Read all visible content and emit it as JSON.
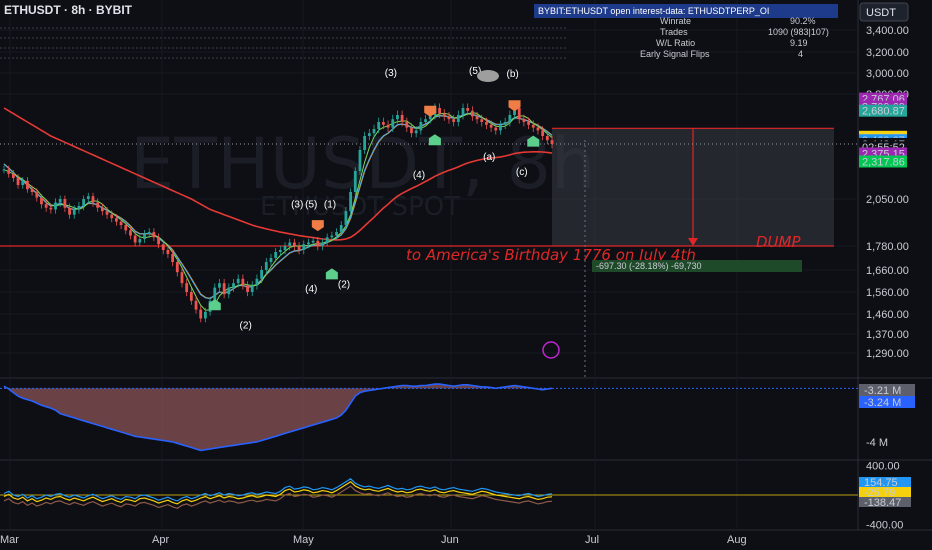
{
  "header": {
    "symbol": "ETHUSDT · 8h · BYBIT",
    "interest_banner": "BYBIT:ETHUSDT open interest-data: ETHUSDTPERP_OI",
    "currency_button": "USDT",
    "watermark_symbol": "ETHUSDT, 8h",
    "watermark_desc": "ETHUSDT SPOT"
  },
  "stats_table": {
    "rows": [
      {
        "label": "Winrate",
        "value": "90.2%"
      },
      {
        "label": "Trades",
        "value": "1090 (983|107)"
      },
      {
        "label": "W/L Ratio",
        "value": "9.19"
      },
      {
        "label": "Early Signal Flips",
        "value": "4"
      }
    ]
  },
  "annotations": {
    "dump_label": "DUMP",
    "birthday_text": "to America's Birthday 1776 on July 4th",
    "measure_text": "-697.30 (-28.18%) -69,730"
  },
  "colors": {
    "up": "#26a69a",
    "down": "#ef5350",
    "ema_red": "#e53935",
    "ema_orange": "#ff9800",
    "ema_blue": "#42a5f5",
    "ema_green": "#7ed957",
    "sell": "#ef7d45",
    "buy": "#5ccf8d"
  },
  "chart_data": [
    {
      "type": "candlestick",
      "name": "main-price",
      "title": "ETHUSDT, 8h",
      "ylim": [
        1290,
        3500
      ],
      "y_ticks": [
        3400,
        3200,
        3000,
        2800,
        2050,
        1780,
        1660,
        1560,
        1460,
        1370,
        1290
      ],
      "y_tick_labels": [
        "3,400.00",
        "3,200.00",
        "3,000.00",
        "2,800.00",
        "2,050.00",
        "1,780.00",
        "1,660.00",
        "1,560.00",
        "1,460.00",
        "1,370.00",
        "1,290.00"
      ],
      "x_tick_labels": [
        "Mar",
        "Apr",
        "May",
        "Jun",
        "Jul",
        "Aug"
      ],
      "price_labels": [
        {
          "value": 2767.06,
          "text": "2,767.06",
          "color": "#9c27b0"
        },
        {
          "value": 2709.69,
          "text": "2,709.69",
          "color": "#9c27b0"
        },
        {
          "value": 2680.87,
          "text": "2,680.87",
          "color": "#26a69a"
        },
        {
          "value": 2494.29,
          "text": "2,494.29",
          "color": "#f5d10d"
        },
        {
          "value": 2469.67,
          "text": "2,469.67",
          "color": "#2196f3"
        },
        {
          "value": 2443.17,
          "text": "2,443.17",
          "color": "#ffffff"
        },
        {
          "value": 2420.0,
          "text": "02:55:52",
          "color": "#ffffff"
        },
        {
          "value": 2375.15,
          "text": "2,375.15",
          "color": "#9c27b0"
        },
        {
          "value": 2317.86,
          "text": "2,317.86",
          "color": "#00c853"
        }
      ],
      "current_price": 2443.17,
      "dump_level_top": 2555,
      "dump_level_bottom": 1780,
      "wave_labels": [
        {
          "text": "(2)",
          "i": 52,
          "v": 1395
        },
        {
          "text": "(3)",
          "i": 63,
          "v": 2000
        },
        {
          "text": "(5)",
          "i": 66,
          "v": 2000
        },
        {
          "text": "(1)",
          "i": 70,
          "v": 2000
        },
        {
          "text": "(4)",
          "i": 66,
          "v": 1560
        },
        {
          "text": "(2)",
          "i": 73,
          "v": 1580
        },
        {
          "text": "(3)",
          "i": 83,
          "v": 2970
        },
        {
          "text": "(4)",
          "i": 89,
          "v": 2200
        },
        {
          "text": "(5)",
          "i": 101,
          "v": 2990
        },
        {
          "text": "(a)",
          "i": 104,
          "v": 2330
        },
        {
          "text": "(b)",
          "i": 109,
          "v": 2960
        },
        {
          "text": "(c)",
          "i": 111,
          "v": 2220
        }
      ],
      "close_series": [
        2260,
        2230,
        2200,
        2150,
        2180,
        2120,
        2100,
        2060,
        2020,
        2000,
        1990,
        2030,
        2050,
        2000,
        1960,
        1990,
        2010,
        2050,
        2070,
        2030,
        2000,
        1980,
        1960,
        1940,
        1920,
        1900,
        1870,
        1840,
        1800,
        1820,
        1850,
        1860,
        1830,
        1790,
        1760,
        1740,
        1700,
        1650,
        1600,
        1560,
        1520,
        1480,
        1440,
        1470,
        1520,
        1580,
        1600,
        1550,
        1580,
        1600,
        1620,
        1590,
        1560,
        1590,
        1620,
        1660,
        1700,
        1720,
        1750,
        1760,
        1780,
        1800,
        1780,
        1760,
        1790,
        1800,
        1810,
        1780,
        1800,
        1830,
        1840,
        1860,
        1900,
        1980,
        2100,
        2250,
        2400,
        2500,
        2520,
        2550,
        2600,
        2580,
        2560,
        2620,
        2650,
        2600,
        2560,
        2520,
        2540,
        2600,
        2620,
        2650,
        2700,
        2660,
        2640,
        2620,
        2600,
        2650,
        2700,
        2680,
        2640,
        2620,
        2600,
        2580,
        2560,
        2540,
        2580,
        2600,
        2650,
        2700,
        2620,
        2600,
        2580,
        2560,
        2540,
        2500,
        2470,
        2443
      ],
      "ema_fast": [
        2300,
        2270,
        2240,
        2200,
        2180,
        2150,
        2120,
        2090,
        2060,
        2030,
        2010,
        2015,
        2025,
        2015,
        1995,
        1990,
        1995,
        2010,
        2025,
        2025,
        2015,
        2000,
        1985,
        1970,
        1955,
        1940,
        1920,
        1895,
        1865,
        1850,
        1850,
        1852,
        1845,
        1825,
        1805,
        1785,
        1760,
        1725,
        1690,
        1655,
        1620,
        1585,
        1550,
        1535,
        1530,
        1545,
        1560,
        1555,
        1562,
        1575,
        1590,
        1590,
        1582,
        1585,
        1595,
        1615,
        1640,
        1660,
        1685,
        1705,
        1725,
        1745,
        1755,
        1757,
        1765,
        1775,
        1785,
        1783,
        1788,
        1800,
        1812,
        1825,
        1845,
        1880,
        1940,
        2030,
        2140,
        2250,
        2330,
        2400,
        2460,
        2500,
        2520,
        2550,
        2580,
        2585,
        2578,
        2562,
        2556,
        2570,
        2585,
        2605,
        2635,
        2645,
        2643,
        2637,
        2627,
        2633,
        2650,
        2660,
        2654,
        2644,
        2632,
        2617,
        2600,
        2583,
        2582,
        2587,
        2605,
        2630,
        2626,
        2618,
        2606,
        2592,
        2576,
        2555,
        2532,
        2505
      ],
      "ema_slow": [
        2700,
        2680,
        2660,
        2640,
        2620,
        2600,
        2580,
        2560,
        2540,
        2520,
        2500,
        2485,
        2470,
        2455,
        2440,
        2425,
        2410,
        2395,
        2380,
        2365,
        2350,
        2335,
        2320,
        2305,
        2290,
        2275,
        2260,
        2245,
        2230,
        2215,
        2200,
        2185,
        2170,
        2155,
        2140,
        2125,
        2110,
        2095,
        2080,
        2065,
        2050,
        2035,
        2020,
        2005,
        1990,
        1980,
        1970,
        1960,
        1950,
        1940,
        1930,
        1920,
        1910,
        1900,
        1892,
        1885,
        1878,
        1872,
        1866,
        1860,
        1855,
        1850,
        1845,
        1840,
        1836,
        1832,
        1828,
        1824,
        1820,
        1818,
        1816,
        1815,
        1816,
        1820,
        1830,
        1848,
        1870,
        1895,
        1920,
        1945,
        1972,
        1998,
        2020,
        2045,
        2070,
        2090,
        2108,
        2125,
        2140,
        2158,
        2175,
        2193,
        2212,
        2228,
        2242,
        2255,
        2266,
        2279,
        2294,
        2307,
        2317,
        2326,
        2333,
        2339,
        2343,
        2346,
        2351,
        2357,
        2365,
        2375,
        2380,
        2384,
        2386,
        2387,
        2387,
        2386,
        2383,
        2378
      ]
    },
    {
      "type": "area",
      "name": "volume-delta",
      "title": "",
      "y_tick_labels": [
        "-4 M"
      ],
      "value_labels": [
        {
          "text": "-3.21 M",
          "color": "#d1d4dc"
        },
        {
          "text": "-3.24 M",
          "color": "#2962ff"
        }
      ],
      "values": [
        -3.21,
        -3.25,
        -3.3,
        -3.35,
        -3.38,
        -3.4,
        -3.42,
        -3.45,
        -3.48,
        -3.5,
        -3.52,
        -3.55,
        -3.6,
        -3.62,
        -3.64,
        -3.66,
        -3.68,
        -3.7,
        -3.72,
        -3.74,
        -3.76,
        -3.78,
        -3.8,
        -3.82,
        -3.84,
        -3.86,
        -3.88,
        -3.9,
        -3.92,
        -3.93,
        -3.94,
        -3.95,
        -3.96,
        -3.97,
        -3.98,
        -3.99,
        -4.0,
        -4.02,
        -4.04,
        -4.06,
        -4.08,
        -4.1,
        -4.12,
        -4.11,
        -4.1,
        -4.09,
        -4.08,
        -4.07,
        -4.06,
        -4.05,
        -4.04,
        -4.03,
        -4.02,
        -4.01,
        -4.0,
        -3.98,
        -3.96,
        -3.94,
        -3.92,
        -3.9,
        -3.88,
        -3.86,
        -3.84,
        -3.82,
        -3.8,
        -3.78,
        -3.76,
        -3.74,
        -3.72,
        -3.7,
        -3.68,
        -3.66,
        -3.62,
        -3.55,
        -3.45,
        -3.35,
        -3.3,
        -3.28,
        -3.27,
        -3.26,
        -3.25,
        -3.24,
        -3.23,
        -3.22,
        -3.21,
        -3.2,
        -3.2,
        -3.21,
        -3.21,
        -3.2,
        -3.2,
        -3.19,
        -3.18,
        -3.18,
        -3.19,
        -3.2,
        -3.21,
        -3.2,
        -3.19,
        -3.19,
        -3.2,
        -3.21,
        -3.22,
        -3.22,
        -3.23,
        -3.24,
        -3.23,
        -3.22,
        -3.21,
        -3.2,
        -3.21,
        -3.22,
        -3.23,
        -3.24,
        -3.25,
        -3.26,
        -3.25,
        -3.24
      ]
    },
    {
      "type": "line",
      "name": "oscillator",
      "title": "",
      "y_tick_labels": [
        "400.00",
        "-400.00"
      ],
      "value_labels": [
        {
          "text": "154.75",
          "color": "#2196f3"
        },
        {
          "text": "-25.79",
          "color": "#f5d10d"
        },
        {
          "text": "-138.47",
          "color": "#d1d4dc"
        }
      ],
      "values": [
        -20,
        10,
        -40,
        -60,
        -30,
        -80,
        -50,
        -90,
        -70,
        -40,
        -60,
        -30,
        -20,
        -50,
        -70,
        -40,
        -60,
        -80,
        -50,
        -30,
        -60,
        -90,
        -70,
        -50,
        -80,
        -100,
        -60,
        -70,
        -90,
        -50,
        -40,
        -60,
        -80,
        -110,
        -90,
        -70,
        -100,
        -120,
        -80,
        -60,
        -90,
        -70,
        -40,
        -20,
        -50,
        -30,
        -10,
        -40,
        -20,
        -30,
        -50,
        -40,
        -20,
        -10,
        -30,
        -20,
        0,
        -10,
        -20,
        10,
        60,
        80,
        40,
        50,
        70,
        60,
        30,
        40,
        60,
        50,
        30,
        60,
        100,
        140,
        180,
        120,
        90,
        70,
        80,
        60,
        50,
        70,
        90,
        60,
        40,
        50,
        30,
        40,
        70,
        80,
        60,
        50,
        70,
        40,
        30,
        50,
        60,
        40,
        30,
        20,
        10,
        30,
        50,
        40,
        20,
        0,
        -10,
        -20,
        -30,
        -40,
        -50,
        -30,
        -20,
        -40,
        -60,
        -50,
        -30,
        -25
      ]
    }
  ]
}
